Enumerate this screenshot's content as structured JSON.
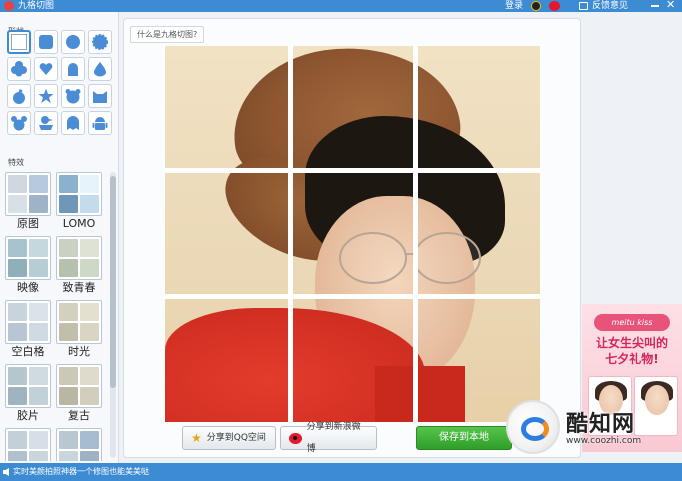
{
  "window": {
    "title": "九格切图",
    "login_label": "登录",
    "feedback_label": "反馈意见"
  },
  "sidebar": {
    "shape_section_label": "形状",
    "effects_section_label": "特效",
    "shapes": [
      "square",
      "rounded-square",
      "circle",
      "scallop",
      "flower",
      "heart",
      "arch",
      "drop",
      "apple",
      "star",
      "bear",
      "cat",
      "bear-ears",
      "duck",
      "ghost",
      "android"
    ],
    "effects": [
      {
        "label": "原图",
        "colors": [
          "#cfd8e2",
          "#b7c9dc",
          "#d9dfe6",
          "#9fb3c7"
        ]
      },
      {
        "label": "LOMO",
        "colors": [
          "#8ab2cf",
          "#e7f3fb",
          "#6f97b8",
          "#c4dbec"
        ]
      },
      {
        "label": "映像",
        "colors": [
          "#a7c3cc",
          "#c5d8de",
          "#8fb0bb",
          "#b6cdd4"
        ]
      },
      {
        "label": "致青春",
        "colors": [
          "#c9d2c2",
          "#dde2d4",
          "#b6c1ad",
          "#cfd7c7"
        ]
      },
      {
        "label": "空白格",
        "colors": [
          "#c8d3dd",
          "#dbe3ea",
          "#b8c6d3",
          "#d0dae3"
        ]
      },
      {
        "label": "时光",
        "colors": [
          "#d3d0c0",
          "#e3e0d0",
          "#c1beac",
          "#d8d5c5"
        ]
      },
      {
        "label": "胶片",
        "colors": [
          "#b5c6cf",
          "#cfdbe1",
          "#9fb4bf",
          "#c2d1d8"
        ]
      },
      {
        "label": "复古",
        "colors": [
          "#cbc8b8",
          "#dedbcc",
          "#b9b6a4",
          "#d1cebe"
        ]
      },
      {
        "label": "",
        "colors": [
          "#c3cfd9",
          "#d6dfe7",
          "#b1c0ce",
          "#cad5de"
        ]
      },
      {
        "label": "",
        "colors": [
          "#b9c7d3",
          "#a8bccf",
          "#c9d4de",
          "#9fb2c4"
        ]
      }
    ]
  },
  "main": {
    "help_link": "什么是九格切图?",
    "grid": {
      "rows": 3,
      "cols": 3
    }
  },
  "actions": {
    "share_qq": "分享到QQ空间",
    "share_weibo": "分享到新浪微博",
    "save": "保存到本地"
  },
  "ad": {
    "brand": "meitu kiss",
    "line1": "让女生尖叫的",
    "line2": "七夕礼物!"
  },
  "watermark": {
    "name": "酷知网",
    "url": "www.coozhi.com"
  },
  "status": {
    "text": "实时美颜拍照神器一个修图也能美美哒"
  },
  "colors": {
    "accent": "#3d8bd3",
    "save_button": "#3aaa35"
  }
}
